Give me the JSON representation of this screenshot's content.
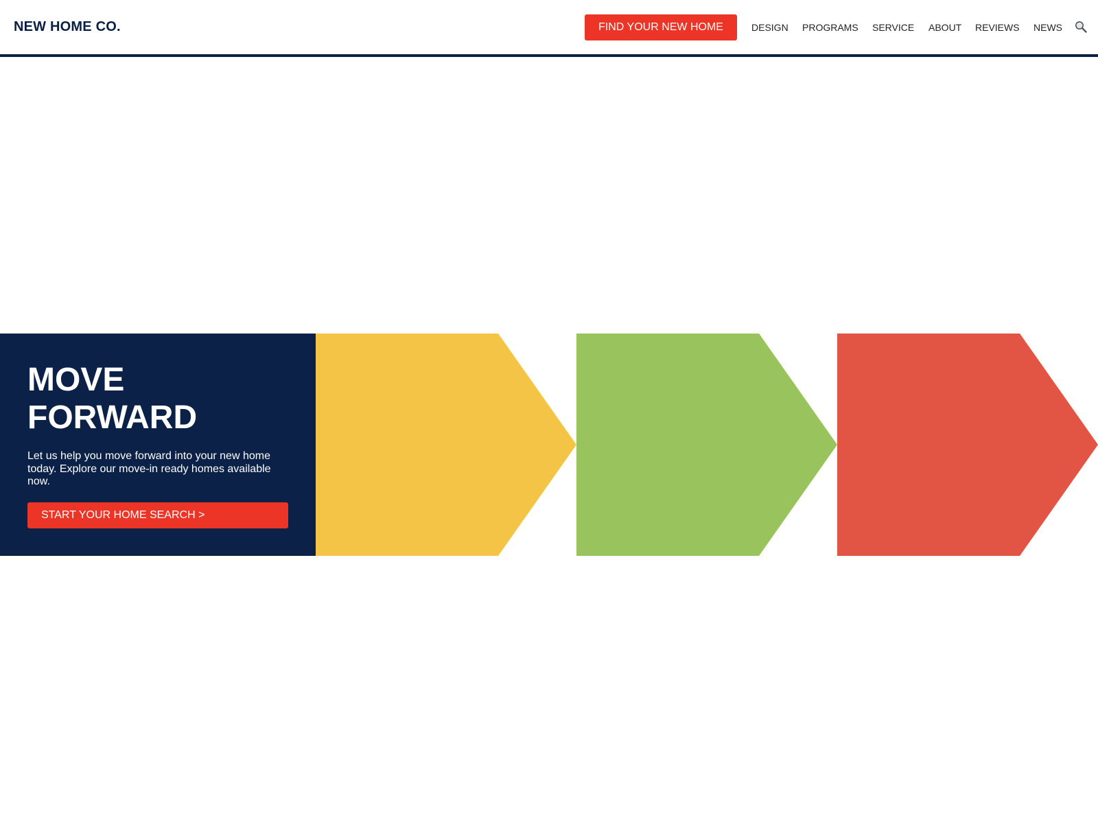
{
  "header": {
    "logo": "NEW HOME CO.",
    "cta_label": "FIND YOUR NEW HOME",
    "nav": [
      "DESIGN",
      "PROGRAMS",
      "SERVICE",
      "ABOUT",
      "REVIEWS",
      "NEWS"
    ],
    "search_icon": "search-icon"
  },
  "hero": {
    "title_line1": "MOVE",
    "title_line2": "FORWARD",
    "text": "Let us help you move forward into your new home today. Explore our move-in ready homes available now.",
    "button_label": "START YOUR HOME SEARCH >"
  },
  "colors": {
    "navy": "#0b2147",
    "accent_red": "#ec3427",
    "arrow_yellow": "#f4c446",
    "arrow_green": "#99c35d",
    "arrow_red": "#e25443"
  }
}
